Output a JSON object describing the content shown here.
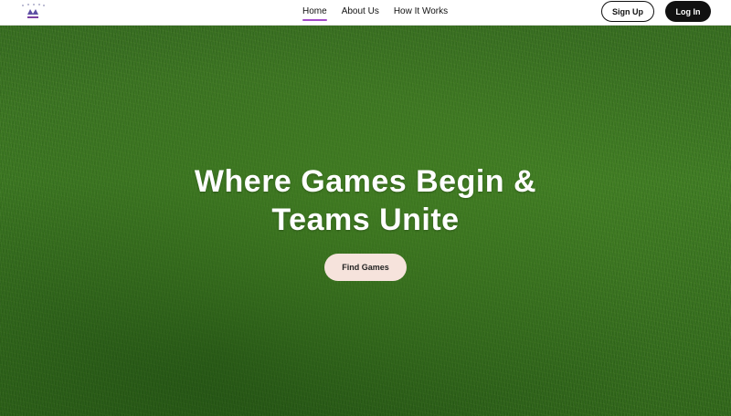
{
  "header": {
    "logo_icon": "sports-logo-icon",
    "nav": [
      {
        "label": "Home",
        "active": true
      },
      {
        "label": "About Us",
        "active": false
      },
      {
        "label": "How It Works",
        "active": false
      }
    ],
    "signup_label": "Sign Up",
    "login_label": "Log In"
  },
  "hero": {
    "title_line1": "Where Games Begin &",
    "title_line2": "Teams Unite",
    "cta_label": "Find Games",
    "background": "grass-field-image"
  },
  "colors": {
    "accent": "#a24bc7",
    "cta_bg": "#f6e3dc",
    "login_bg": "#111111"
  }
}
